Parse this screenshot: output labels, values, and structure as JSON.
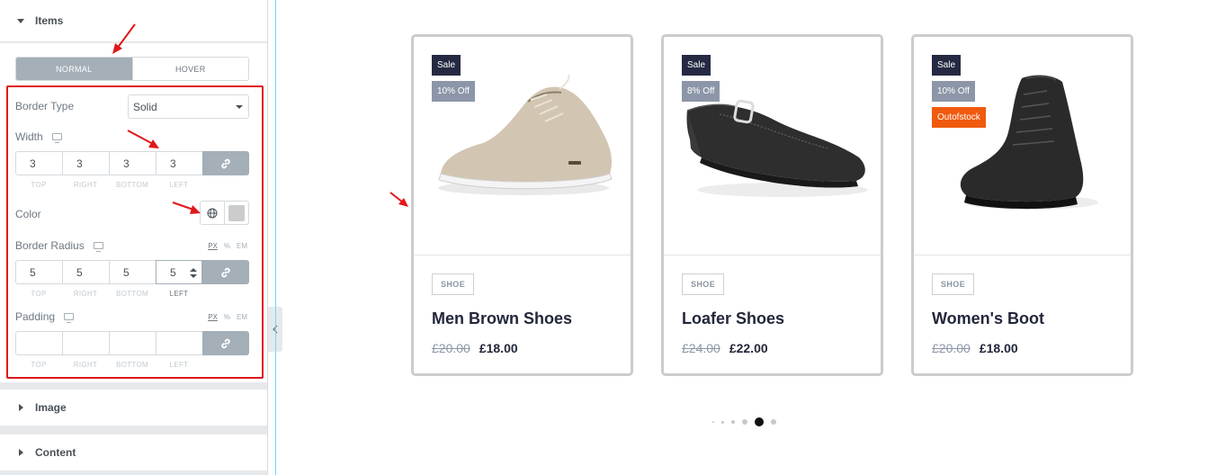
{
  "panel": {
    "items_section": {
      "title": "Items"
    },
    "tabs": [
      {
        "label": "NORMAL",
        "active": true
      },
      {
        "label": "HOVER",
        "active": false
      }
    ],
    "border_type": {
      "label": "Border Type",
      "value": "Solid"
    },
    "width": {
      "label": "Width",
      "values": [
        "3",
        "3",
        "3",
        "3"
      ],
      "sides": [
        "TOP",
        "RIGHT",
        "BOTTOM",
        "LEFT"
      ]
    },
    "color": {
      "label": "Color",
      "swatch": "#cccccc"
    },
    "border_radius": {
      "label": "Border Radius",
      "units": [
        "PX",
        "%",
        "EM"
      ],
      "values": [
        "5",
        "5",
        "5",
        "5"
      ],
      "sides": [
        "TOP",
        "RIGHT",
        "BOTTOM",
        "LEFT"
      ]
    },
    "padding": {
      "label": "Padding",
      "units": [
        "PX",
        "%",
        "EM"
      ],
      "values": [
        "",
        "",
        "",
        ""
      ],
      "sides": [
        "TOP",
        "RIGHT",
        "BOTTOM",
        "LEFT"
      ]
    },
    "image_section": {
      "title": "Image"
    },
    "content_section": {
      "title": "Content"
    }
  },
  "products": [
    {
      "badges": {
        "sale": "Sale",
        "discount": "10% Off"
      },
      "category": "SHOE",
      "title": "Men Brown Shoes",
      "old_price": "£20.00",
      "new_price": "£18.00",
      "shoe_color": "#d2c5b2"
    },
    {
      "badges": {
        "sale": "Sale",
        "discount": "8% Off"
      },
      "category": "SHOE",
      "title": "Loafer Shoes",
      "old_price": "£24.00",
      "new_price": "£22.00",
      "shoe_color": "#2e2e2e"
    },
    {
      "badges": {
        "sale": "Sale",
        "discount": "10% Off",
        "stock": "Outofstock"
      },
      "category": "SHOE",
      "title": "Women's Boot",
      "old_price": "£20.00",
      "new_price": "£18.00",
      "shoe_color": "#2a2a2a"
    }
  ],
  "carousel": {
    "dot_count": 6,
    "active_index": 4
  },
  "colors": {
    "annotation_red": "#e0171b",
    "badge_dark": "#252a42",
    "badge_grey": "#8c96a8",
    "badge_orange": "#f05a0e",
    "editor_accent": "#71d7f7"
  }
}
